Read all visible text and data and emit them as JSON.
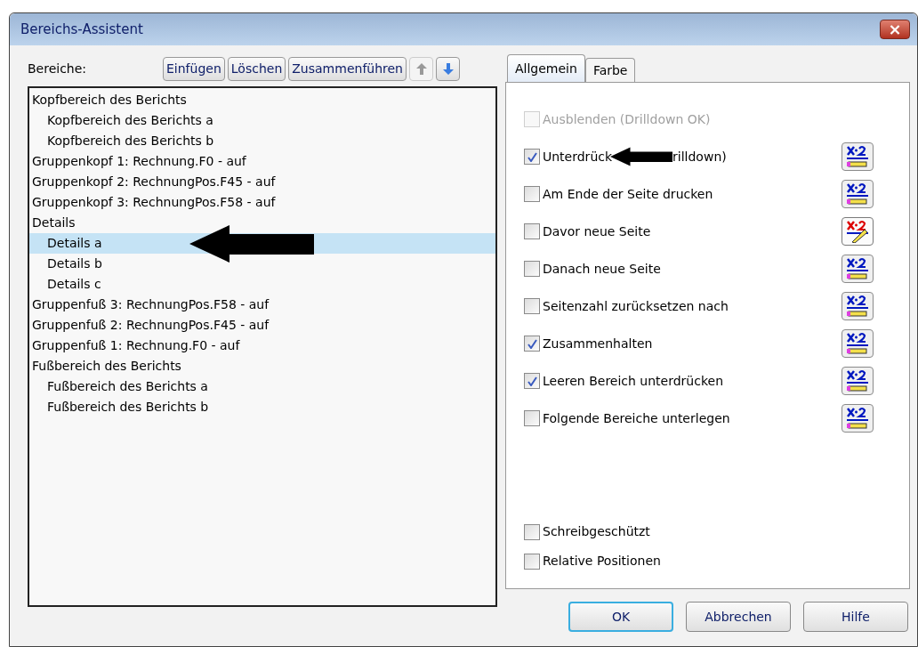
{
  "window": {
    "title": "Bereichs-Assistent",
    "close": "×"
  },
  "sections": {
    "label": "Bereiche:",
    "buttons": [
      {
        "label": "Einfügen",
        "kind": "text"
      },
      {
        "label": "Löschen",
        "kind": "text"
      },
      {
        "label": "Zusammenführen",
        "kind": "text"
      },
      {
        "kind": "up",
        "disabled": true
      },
      {
        "kind": "down",
        "disabled": false
      }
    ],
    "tree": [
      {
        "label": "Kopfbereich des Berichts",
        "selected": false,
        "children": [
          {
            "label": "Kopfbereich des Berichts a",
            "selected": false
          },
          {
            "label": "Kopfbereich des Berichts b",
            "selected": false
          }
        ]
      },
      {
        "label": "Gruppenkopf 1: Rechnung.F0 - auf",
        "selected": false
      },
      {
        "label": "Gruppenkopf 2: RechnungPos.F45 - auf",
        "selected": false
      },
      {
        "label": "Gruppenkopf 3: RechnungPos.F58 - auf",
        "selected": false
      },
      {
        "label": "Details",
        "selected": false,
        "children": [
          {
            "label": "Details a",
            "selected": true,
            "arrow": true
          },
          {
            "label": "Details b",
            "selected": false
          },
          {
            "label": "Details c",
            "selected": false
          }
        ]
      },
      {
        "label": "Gruppenfuß 3: RechnungPos.F58 - auf",
        "selected": false
      },
      {
        "label": "Gruppenfuß 2: RechnungPos.F45 - auf",
        "selected": false
      },
      {
        "label": "Gruppenfuß 1: Rechnung.F0 - auf",
        "selected": false
      },
      {
        "label": "Fußbereich des Berichts",
        "selected": false,
        "children": [
          {
            "label": "Fußbereich des Berichts a",
            "selected": false
          },
          {
            "label": "Fußbereich des Berichts b",
            "selected": false
          }
        ]
      }
    ]
  },
  "tabs": [
    {
      "label": "Allgemein",
      "selected": true
    },
    {
      "label": "Farbe",
      "selected": false
    }
  ],
  "options": [
    {
      "label": "Ausblenden (Drilldown OK)",
      "checked": false,
      "disabled": true,
      "formula_button": false,
      "formula_set": false
    },
    {
      "label": "Unterdrück",
      "label_end": "rilldown)",
      "checked": true,
      "disabled": false,
      "formula_button": true,
      "formula_set": false
    },
    {
      "label": "Am Ende der Seite drucken",
      "checked": false,
      "disabled": false,
      "formula_button": true,
      "formula_set": false
    },
    {
      "label": "Davor neue Seite",
      "checked": false,
      "disabled": false,
      "formula_button": true,
      "formula_set": true
    },
    {
      "label": "Danach neue Seite",
      "checked": false,
      "disabled": false,
      "formula_button": true,
      "formula_set": false
    },
    {
      "label": "Seitenzahl zurücksetzen nach",
      "checked": false,
      "disabled": false,
      "formula_button": true,
      "formula_set": false
    },
    {
      "label": "Zusammenhalten",
      "checked": true,
      "disabled": false,
      "formula_button": true,
      "formula_set": false
    },
    {
      "label": "Leeren Bereich unterdrücken",
      "checked": true,
      "disabled": false,
      "formula_button": true,
      "formula_set": false
    },
    {
      "label": "Folgende Bereiche unterlegen",
      "checked": false,
      "disabled": false,
      "formula_button": true,
      "formula_set": false
    }
  ],
  "bottom_options": [
    {
      "label": "Schreibgeschützt",
      "checked": false
    },
    {
      "label": "Relative Positionen",
      "checked": false
    }
  ],
  "buttons": [
    {
      "label": "OK",
      "selected": true
    },
    {
      "label": "Abbrechen",
      "selected": false
    },
    {
      "label": "Hilfe",
      "selected": false
    }
  ]
}
